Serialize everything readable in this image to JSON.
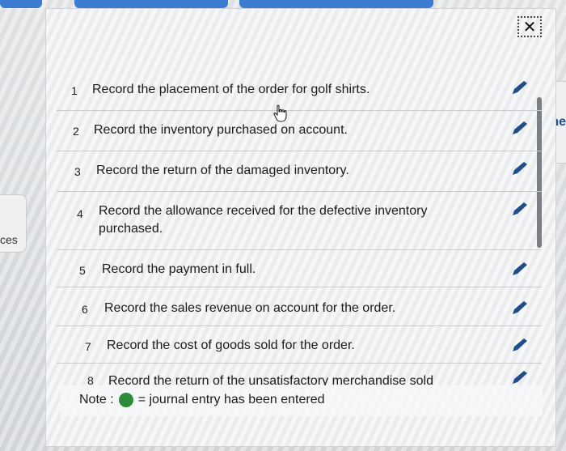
{
  "background": {
    "left_fragment": "ces",
    "right_fragment": "ne"
  },
  "modal": {
    "close_label": "✕",
    "items": [
      {
        "num": "1",
        "label": "Record the placement of the order for golf shirts."
      },
      {
        "num": "2",
        "label": "Record the inventory purchased on account."
      },
      {
        "num": "3",
        "label": "Record the return of the damaged inventory."
      },
      {
        "num": "4",
        "label": "Record the allowance received for the defective inventory purchased."
      },
      {
        "num": "5",
        "label": "Record the payment in full."
      },
      {
        "num": "6",
        "label": "Record the sales revenue on account for the order."
      },
      {
        "num": "7",
        "label": "Record the cost of goods sold for the order."
      },
      {
        "num": "8",
        "label": "Record the return of the unsatisfactory merchandise sold"
      }
    ],
    "note": {
      "prefix": "Note :",
      "suffix": "= journal entry has been entered"
    },
    "colors": {
      "pencil": "#1f4e8a",
      "entered_dot": "#2e8b3a"
    }
  }
}
